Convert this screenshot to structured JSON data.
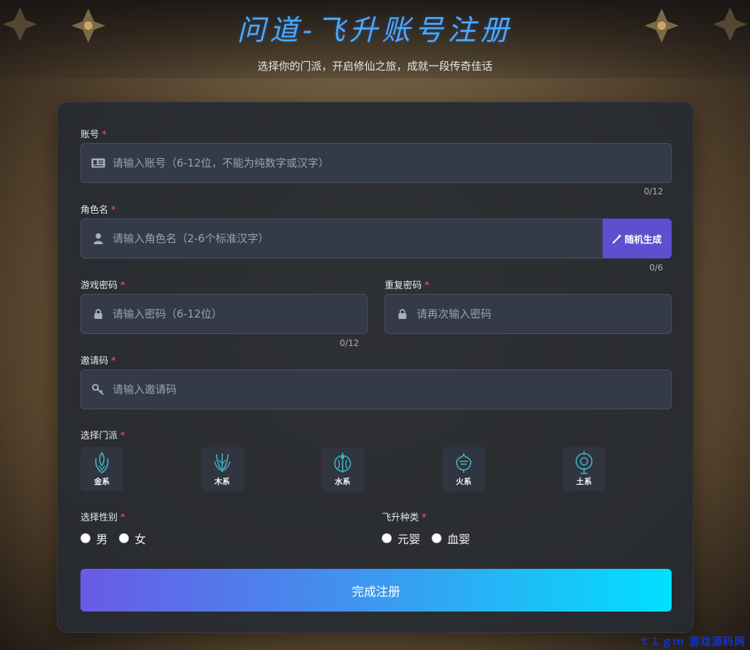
{
  "header": {
    "title": "问道-飞升账号注册",
    "subtitle": "选择你的门派，开启修仙之旅，成就一段传奇佳话"
  },
  "form": {
    "required_mark": "*",
    "account": {
      "label": "账号",
      "placeholder": "请输入账号（6-12位，不能为纯数字或汉字）",
      "counter": "0/12",
      "icon": "id-card-icon"
    },
    "role_name": {
      "label": "角色名",
      "placeholder": "请输入角色名（2-6个标准汉字）",
      "counter": "0/6",
      "icon": "user-icon",
      "generate_label": "随机生成",
      "generate_icon": "magic-wand-icon"
    },
    "password": {
      "label": "游戏密码",
      "placeholder": "请输入密码（6-12位）",
      "counter": "0/12",
      "icon": "lock-icon"
    },
    "repeat_password": {
      "label": "重复密码",
      "placeholder": "请再次输入密码",
      "icon": "lock-icon"
    },
    "invite_code": {
      "label": "邀请码",
      "placeholder": "请输入邀请码",
      "icon": "key-icon"
    },
    "sect": {
      "label": "选择门派",
      "options": [
        {
          "label": "金系",
          "icon": "metal-sect-icon"
        },
        {
          "label": "木系",
          "icon": "wood-sect-icon"
        },
        {
          "label": "水系",
          "icon": "water-sect-icon"
        },
        {
          "label": "火系",
          "icon": "fire-sect-icon"
        },
        {
          "label": "土系",
          "icon": "earth-sect-icon"
        }
      ]
    },
    "gender": {
      "label": "选择性别",
      "options": [
        "男",
        "女"
      ]
    },
    "ascension": {
      "label": "飞升种类",
      "options": [
        "元婴",
        "血婴"
      ]
    },
    "submit_label": "完成注册"
  },
  "watermark": "ｔ１ｇｍ 游戏源码网",
  "colors": {
    "accent_title": "#4aa8ff",
    "generate_button": "#5f4fcf",
    "submit_gradient_start": "#6a5ae6",
    "submit_gradient_end": "#00e0ff",
    "required": "#ff5a5a",
    "sect_icon": "#3fb6c4"
  }
}
